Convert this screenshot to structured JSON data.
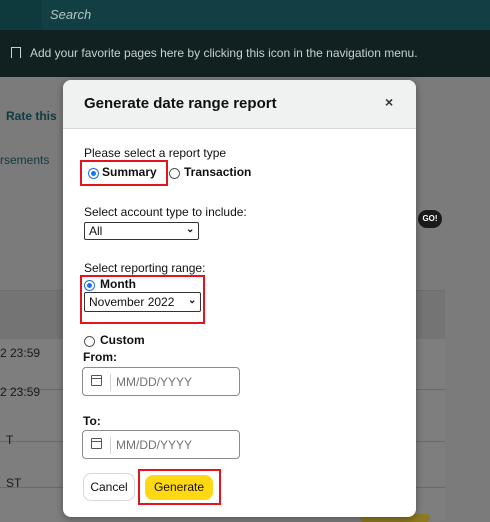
{
  "background": {
    "search_placeholder": "Search",
    "favorites_hint": "Add your favorite pages here by clicking this icon in the navigation menu.",
    "rate_link": "Rate this",
    "disbursements_link": "rsements",
    "go_badge": "GO!",
    "rows": [
      "2 23:59",
      "2 23:59",
      "T",
      "ST"
    ]
  },
  "modal": {
    "title": "Generate date range report",
    "close": "×",
    "report_type_label": "Please select a report type",
    "summary_label": "Summary",
    "transaction_label": "Transaction",
    "account_type_label": "Select account type to include:",
    "account_type_value": "All",
    "range_label": "Select reporting range:",
    "month_label": "Month",
    "month_value": "November 2022",
    "custom_label": "Custom",
    "from_label": "From:",
    "to_label": "To:",
    "date_placeholder": "MM/DD/YYYY",
    "cancel_label": "Cancel",
    "generate_label": "Generate"
  },
  "colors": {
    "primary_button": "#ffd814",
    "annotation": "#e3141e",
    "radio_selected": "#1a73e8"
  }
}
